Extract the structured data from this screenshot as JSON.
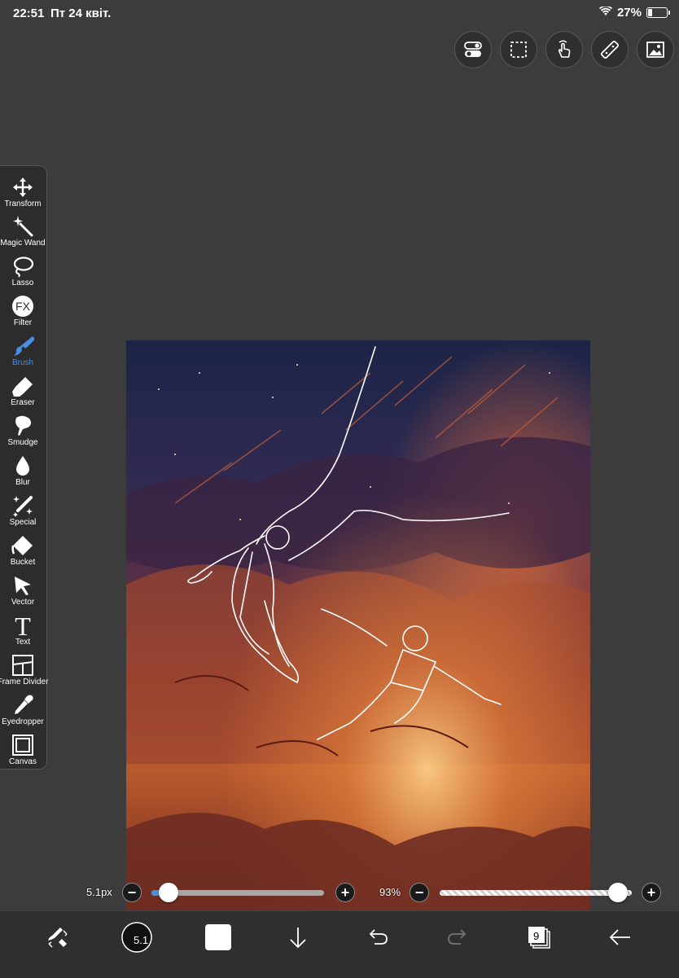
{
  "status_bar": {
    "time": "22:51",
    "date": "Пт 24 квіт.",
    "battery_text": "27%",
    "battery_level": 0.27
  },
  "top_tools": [
    {
      "name": "layer-toggle-icon"
    },
    {
      "name": "selection-icon"
    },
    {
      "name": "finger-touch-icon"
    },
    {
      "name": "ruler-icon"
    },
    {
      "name": "image-icon"
    }
  ],
  "tools": [
    {
      "id": "transform",
      "label": "Transform",
      "icon": "move-arrows-icon"
    },
    {
      "id": "magic-wand",
      "label": "Magic Wand",
      "icon": "magic-wand-icon"
    },
    {
      "id": "lasso",
      "label": "Lasso",
      "icon": "lasso-icon"
    },
    {
      "id": "filter",
      "label": "Filter",
      "icon": "fx-icon"
    },
    {
      "id": "brush",
      "label": "Brush",
      "icon": "brush-icon",
      "active": true
    },
    {
      "id": "eraser",
      "label": "Eraser",
      "icon": "eraser-icon"
    },
    {
      "id": "smudge",
      "label": "Smudge",
      "icon": "smudge-icon"
    },
    {
      "id": "blur",
      "label": "Blur",
      "icon": "drop-icon"
    },
    {
      "id": "special",
      "label": "Special",
      "icon": "sparkle-pen-icon"
    },
    {
      "id": "bucket",
      "label": "Bucket",
      "icon": "bucket-icon"
    },
    {
      "id": "vector",
      "label": "Vector",
      "icon": "cursor-arrow-icon"
    },
    {
      "id": "text",
      "label": "Text",
      "icon": "text-t-icon"
    },
    {
      "id": "frame-divider",
      "label": "Frame Divider",
      "icon": "frame-divider-icon"
    },
    {
      "id": "eyedropper",
      "label": "Eyedropper",
      "icon": "eyedropper-icon"
    },
    {
      "id": "canvas",
      "label": "Canvas",
      "icon": "canvas-icon"
    }
  ],
  "brush_size": {
    "label": "5.1px",
    "value_fraction": 0.1
  },
  "opacity": {
    "label": "93%",
    "value_fraction": 0.93
  },
  "bottom_bar": {
    "brush_size_badge": "5.1",
    "layers_count": "9",
    "color": "#ffffff"
  },
  "colors": {
    "accent": "#4a90e2",
    "background": "#3c3c3c",
    "panel": "#2c2c2c"
  }
}
